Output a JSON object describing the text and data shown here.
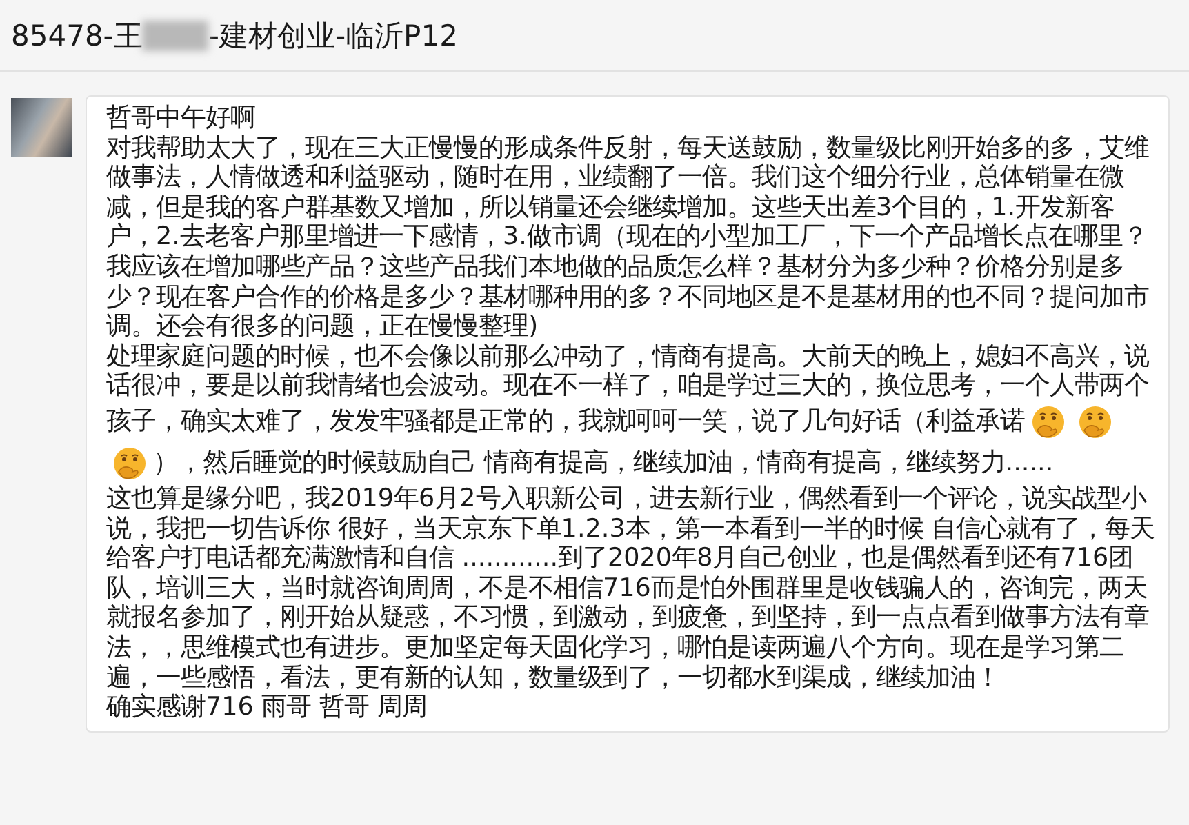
{
  "window": {
    "title_prefix": "85478-王",
    "title_redacted": true,
    "title_suffix": "-建材创业-临沂P12"
  },
  "message": {
    "paragraphs": [
      {
        "segments": [
          {
            "kind": "text",
            "text": "哲哥中午好啊"
          }
        ]
      },
      {
        "segments": [
          {
            "kind": "text",
            "text": "对我帮助太大了，现在三大正慢慢的形成条件反射，每天送鼓励，数量级比刚开始多的多，艾维做事法，人情做透和利益驱动，随时在用，业绩翻了一倍。我们这个细分行业，总体销量在微减，但是我的客户群基数又增加，所以销量还会继续增加。这些天出差3个目的，1.开发新客户，2.去老客户那里增进一下感情，3.做市调（现在的小型加工厂，下一个产品增长点在哪里？我应该在增加哪些产品？这些产品我们本地做的品质怎么样？基材分为多少种？价格分别是多少？现在客户合作的价格是多少？基材哪种用的多？不同地区是不是基材用的也不同？提问加市调。还会有很多的问题，正在慢慢整理)"
          }
        ]
      },
      {
        "segments": [
          {
            "kind": "block",
            "text": "处理家庭问题的时候，也不会像以前那么冲动了，情商有提高。大前天的晚上，媳妇不高兴，说话很冲，要是以前我情绪也会波动。现在不一样了，咱是学过三大的，换位思考，一个人带两个"
          },
          {
            "kind": "text",
            "text": "孩子，确实太难了，发发牢骚都是正常的，我就呵呵一笑，说了几句好话（利益承诺"
          },
          {
            "kind": "emoji"
          },
          {
            "kind": "emoji"
          },
          {
            "kind": "emoji"
          },
          {
            "kind": "text",
            "text": "），然后睡觉的时候鼓励自己 情商有提高，继续加油，情商有提高，继续努力......"
          }
        ]
      },
      {
        "segments": [
          {
            "kind": "text",
            "text": "这也算是缘分吧，我2019年6月2号入职新公司，进去新行业，偶然看到一个评论，说实战型小说，我把一切告诉你  很好，当天京东下单1.2.3本，第一本看到一半的时候 自信心就有了，每天给客户打电话都充满激情和自信  ............到了2020年8月自己创业，也是偶然看到还有716团队，培训三大，当时就咨询周周，不是不相信716而是怕外围群里是收钱骗人的，咨询完，两天就报名参加了，刚开始从疑惑，不习惯，到激动，到疲惫，到坚持，到一点点看到做事方法有章法，，思维模式也有进步。更加坚定每天固化学习，哪怕是读两遍八个方向。现在是学习第二遍，一些感悟，看法，更有新的认知，数量级到了，一切都水到渠成，继续加油！"
          }
        ]
      },
      {
        "segments": [
          {
            "kind": "text",
            "text": "确实感谢716 雨哥 哲哥 周周"
          }
        ]
      }
    ]
  }
}
